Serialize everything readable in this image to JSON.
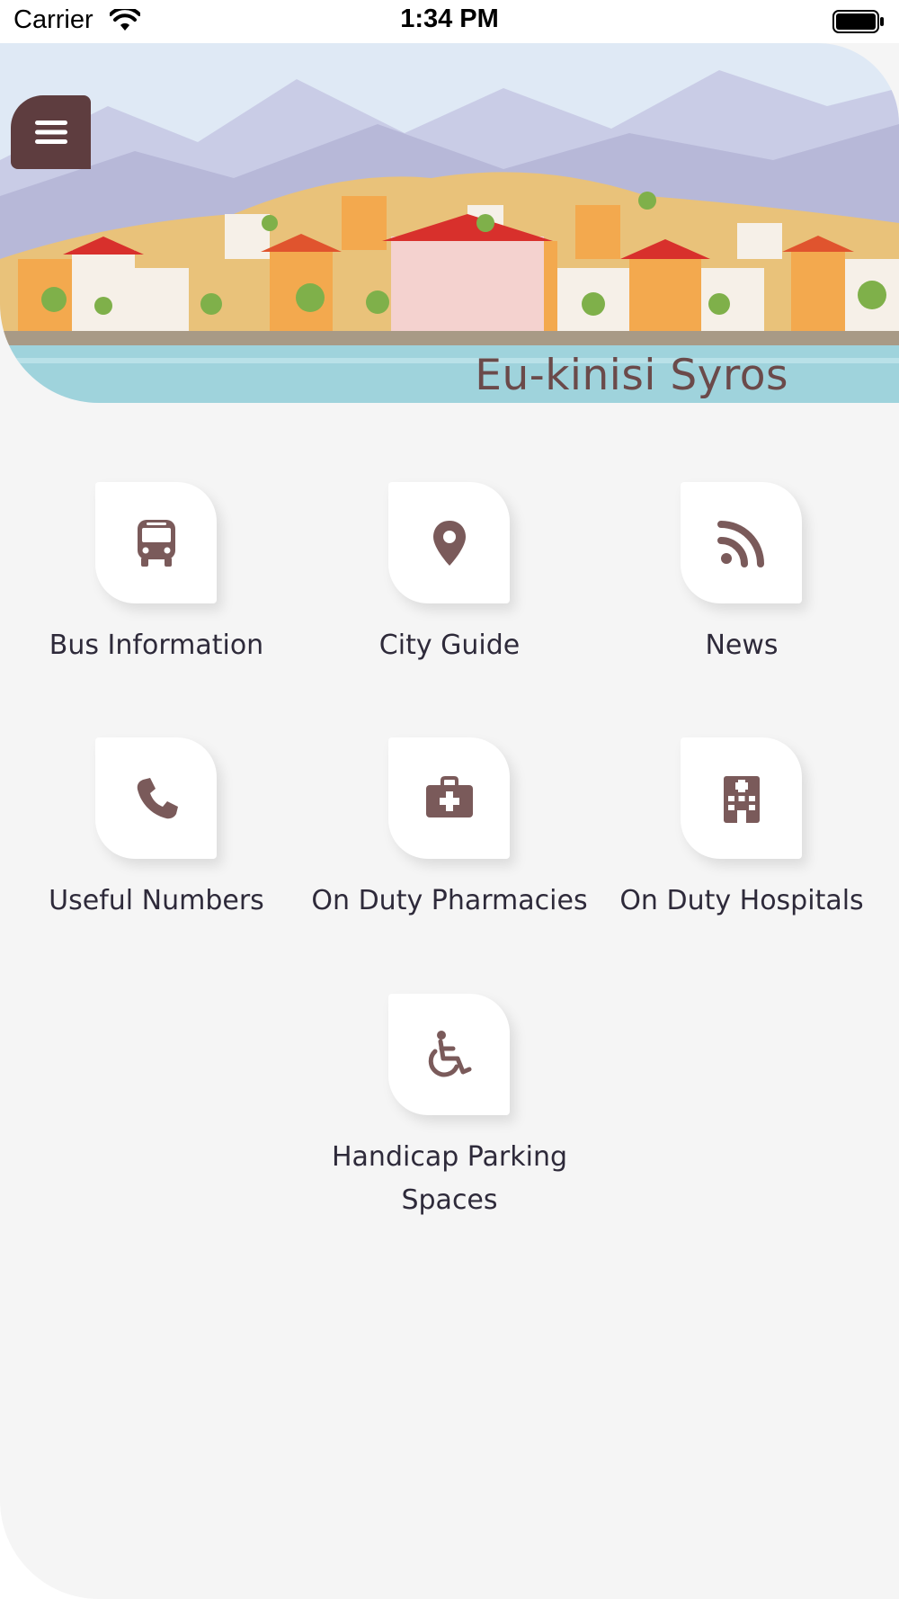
{
  "status_bar": {
    "carrier": "Carrier",
    "time": "1:34 PM"
  },
  "header": {
    "title": "Eu-kinisi Syros"
  },
  "colors": {
    "accent": "#5e3d3f",
    "icon": "#7a5a5a",
    "background": "#f5f5f5"
  },
  "menu": [
    {
      "label": "Bus Information",
      "icon": "bus-icon"
    },
    {
      "label": "City Guide",
      "icon": "map-pin-icon"
    },
    {
      "label": "News",
      "icon": "rss-icon"
    },
    {
      "label": "Useful Numbers",
      "icon": "phone-icon"
    },
    {
      "label": "On Duty Pharmacies",
      "icon": "first-aid-kit-icon"
    },
    {
      "label": "On Duty Hospitals",
      "icon": "hospital-icon"
    },
    {
      "label": "Handicap Parking Spaces",
      "icon": "wheelchair-icon"
    }
  ]
}
